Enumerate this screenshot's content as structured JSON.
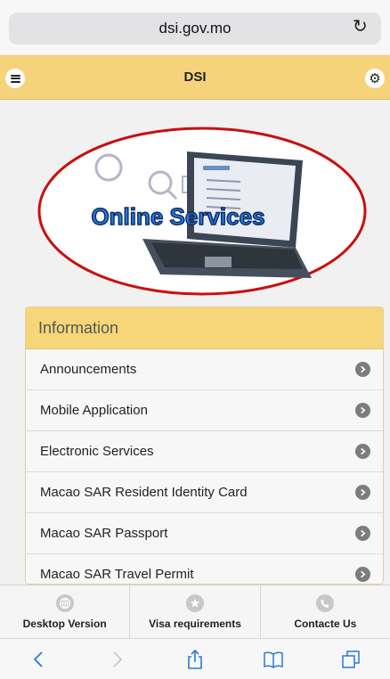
{
  "browser": {
    "url": "dsi.gov.mo"
  },
  "header": {
    "title": "DSI"
  },
  "banner": {
    "text": "Online Services"
  },
  "info": {
    "heading": "Information",
    "items": [
      {
        "label": "Announcements"
      },
      {
        "label": "Mobile Application"
      },
      {
        "label": "Electronic Services"
      },
      {
        "label": "Macao SAR Resident Identity Card"
      },
      {
        "label": "Macao SAR Passport"
      },
      {
        "label": "Macao SAR Travel Permit"
      }
    ]
  },
  "tabbar": {
    "desktop": "Desktop Version",
    "visa": "Visa requirements",
    "contact": "Contacte Us"
  },
  "colors": {
    "header_bg": "#f6d37a",
    "accent_blue": "#2a7ad6",
    "ring": "#c81010"
  }
}
